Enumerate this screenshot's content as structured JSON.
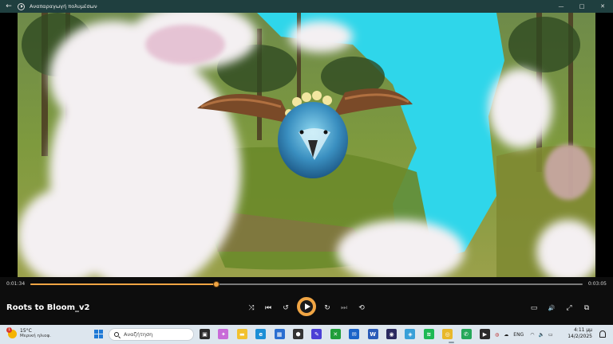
{
  "window": {
    "title": "Αναπαραγωγή πολυμέσων",
    "back_glyph": "←",
    "minimize_glyph": "—",
    "maximize_glyph": "□",
    "close_glyph": "✕"
  },
  "player": {
    "current_time": "0:01:34",
    "total_time": "0:03:05",
    "progress": 0.337,
    "media_title": "Roots to Bloom_v2",
    "accent_color": "#f0a544",
    "buttons": {
      "shuffle": "⤨",
      "previous": "⏮",
      "rewind": "↺",
      "forward": "↻",
      "next": "⏭",
      "repeat": "⟲",
      "miniplayer": "▭",
      "volume": "🔊",
      "fullscreen": "⤢",
      "cast": "⧉"
    }
  },
  "taskbar": {
    "weather_temp": "15°C",
    "weather_desc": "Μερική ηλιοφ.",
    "weather_badge": "1",
    "search_placeholder": "Αναζήτηση",
    "language": "ENG",
    "time": "4:11 μμ",
    "date": "14/2/2025",
    "apps": [
      {
        "name": "task-view",
        "color": "#2b2b2b",
        "glyph": "▣"
      },
      {
        "name": "copilot",
        "color": "#c86ad8",
        "glyph": "✦"
      },
      {
        "name": "file-explorer",
        "color": "#f2c12e",
        "glyph": "▬"
      },
      {
        "name": "edge",
        "color": "#1b8fd6",
        "glyph": "e"
      },
      {
        "name": "store",
        "color": "#2a6fd1",
        "glyph": "▦"
      },
      {
        "name": "github-desktop",
        "color": "#333333",
        "glyph": "⬢"
      },
      {
        "name": "pen-app",
        "color": "#4b3fd6",
        "glyph": "✎"
      },
      {
        "name": "xbox",
        "color": "#1f9e3a",
        "glyph": "✕"
      },
      {
        "name": "outlook",
        "color": "#1a63c8",
        "glyph": "✉"
      },
      {
        "name": "word",
        "color": "#2a5bb8",
        "glyph": "W"
      },
      {
        "name": "messenger",
        "color": "#2a2a60",
        "glyph": "◉"
      },
      {
        "name": "maps",
        "color": "#38a0d8",
        "glyph": "◈"
      },
      {
        "name": "spotify",
        "color": "#1db954",
        "glyph": "≋"
      },
      {
        "name": "chrome",
        "color": "#e8b82a",
        "glyph": "◎"
      },
      {
        "name": "whatsapp",
        "color": "#25a85a",
        "glyph": "✆"
      },
      {
        "name": "media-player",
        "color": "#2b2b2b",
        "glyph": "▶"
      }
    ]
  }
}
